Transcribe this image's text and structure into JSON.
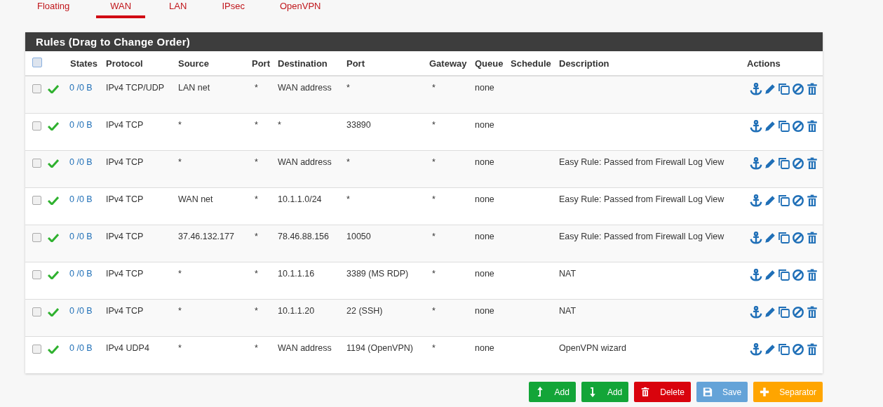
{
  "tabs": [
    {
      "label": "Floating",
      "selected": false
    },
    {
      "label": "WAN",
      "selected": true
    },
    {
      "label": "LAN",
      "selected": false
    },
    {
      "label": "IPsec",
      "selected": false
    },
    {
      "label": "OpenVPN",
      "selected": false
    }
  ],
  "panel": {
    "title": "Rules (Drag to Change Order)",
    "select_all": {
      "checked": false
    },
    "columns": [
      "States",
      "Protocol",
      "Source",
      "Port",
      "Destination",
      "Port",
      "Gateway",
      "Queue",
      "Schedule",
      "Description",
      "Actions"
    ],
    "rows": [
      {
        "checked": false,
        "enabled": true,
        "states": "0 /0 B",
        "protocol": "IPv4 TCP/UDP",
        "source": "LAN net",
        "source_port": "*",
        "destination": "WAN address",
        "destination_port": "*",
        "gateway": "*",
        "queue": "none",
        "schedule": "",
        "description": ""
      },
      {
        "checked": false,
        "enabled": true,
        "states": "0 /0 B",
        "protocol": "IPv4 TCP",
        "source": "*",
        "source_port": "*",
        "destination": "*",
        "destination_port": "33890",
        "gateway": "*",
        "queue": "none",
        "schedule": "",
        "description": ""
      },
      {
        "checked": false,
        "enabled": true,
        "states": "0 /0 B",
        "protocol": "IPv4 TCP",
        "source": "*",
        "source_port": "*",
        "destination": "WAN address",
        "destination_port": "*",
        "gateway": "*",
        "queue": "none",
        "schedule": "",
        "description": "Easy Rule: Passed from Firewall Log View"
      },
      {
        "checked": false,
        "enabled": true,
        "states": "0 /0 B",
        "protocol": "IPv4 TCP",
        "source": "WAN net",
        "source_port": "*",
        "destination": "10.1.1.0/24",
        "destination_port": "*",
        "gateway": "*",
        "queue": "none",
        "schedule": "",
        "description": "Easy Rule: Passed from Firewall Log View"
      },
      {
        "checked": false,
        "enabled": true,
        "states": "0 /0 B",
        "protocol": "IPv4 TCP",
        "source": "37.46.132.177",
        "source_port": "*",
        "destination": "78.46.88.156",
        "destination_port": "10050",
        "gateway": "*",
        "queue": "none",
        "schedule": "",
        "description": "Easy Rule: Passed from Firewall Log View"
      },
      {
        "checked": false,
        "enabled": true,
        "states": "0 /0 B",
        "protocol": "IPv4 TCP",
        "source": "*",
        "source_port": "*",
        "destination": "10.1.1.16",
        "destination_port": "3389 (MS RDP)",
        "gateway": "*",
        "queue": "none",
        "schedule": "",
        "description": "NAT"
      },
      {
        "checked": false,
        "enabled": true,
        "states": "0 /0 B",
        "protocol": "IPv4 TCP",
        "source": "*",
        "source_port": "*",
        "destination": "10.1.1.20",
        "destination_port": "22 (SSH)",
        "gateway": "*",
        "queue": "none",
        "schedule": "",
        "description": "NAT"
      },
      {
        "checked": false,
        "enabled": true,
        "states": "0 /0 B",
        "protocol": "IPv4 UDP4",
        "source": "*",
        "source_port": "*",
        "destination": "WAN address",
        "destination_port": "1194 (OpenVPN)",
        "gateway": "*",
        "queue": "none",
        "schedule": "",
        "description": "OpenVPN wizard"
      }
    ]
  },
  "buttons": [
    {
      "kind": "add-top",
      "label": "Add"
    },
    {
      "kind": "add-bottom",
      "label": "Add"
    },
    {
      "kind": "delete",
      "label": "Delete"
    },
    {
      "kind": "save",
      "label": "Save"
    },
    {
      "kind": "separator",
      "label": "Separator"
    }
  ]
}
